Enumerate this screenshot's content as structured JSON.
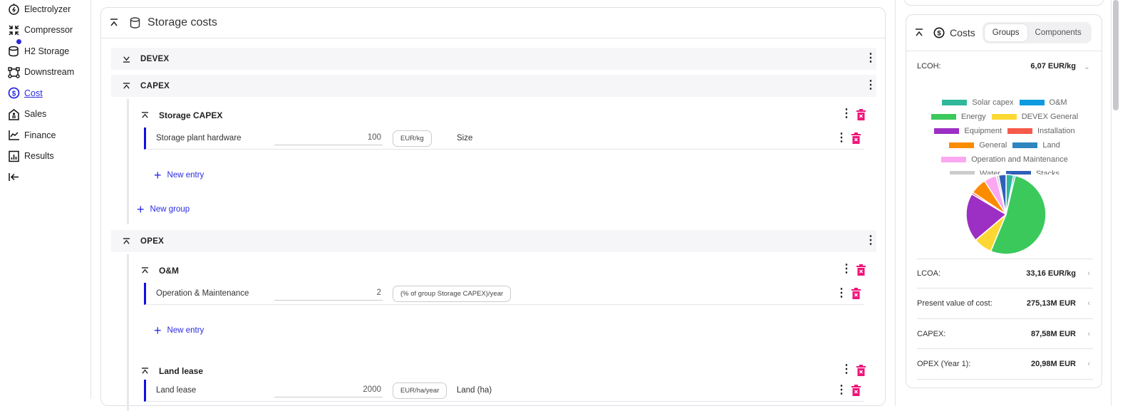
{
  "sidebar": {
    "items": [
      {
        "label": "Electrolyzer",
        "icon": "electrolyzer-icon"
      },
      {
        "label": "Compressor",
        "icon": "compressor-icon"
      },
      {
        "label": "H2 Storage",
        "icon": "storage-icon"
      },
      {
        "label": "Downstream",
        "icon": "downstream-icon"
      },
      {
        "label": "Cost",
        "icon": "dollar-icon",
        "active": true
      },
      {
        "label": "Sales",
        "icon": "sales-icon"
      },
      {
        "label": "Finance",
        "icon": "chart-line-icon"
      },
      {
        "label": "Results",
        "icon": "results-icon"
      }
    ],
    "collapse_icon": "collapse-left-icon"
  },
  "main": {
    "title": "Storage costs",
    "sections": [
      {
        "label": "DEVEX",
        "collapsed": true
      },
      {
        "label": "CAPEX"
      },
      {
        "label": "OPEX"
      }
    ],
    "groups": [
      {
        "label": "Storage CAPEX",
        "entries": [
          {
            "name": "Storage plant hardware",
            "value": "100",
            "unit": "EUR/kg",
            "extra": "Size"
          }
        ],
        "new_entry": "New entry"
      },
      {
        "label": "O&M",
        "entries": [
          {
            "name": "Operation & Maintenance",
            "value": "2",
            "unit": "(% of group Storage CAPEX)/year"
          }
        ],
        "new_entry": "New entry"
      },
      {
        "label": "Land lease",
        "entries": [
          {
            "name": "Land lease",
            "value": "2000",
            "unit": "EUR/ha/year",
            "extra": "Land (ha)"
          }
        ]
      }
    ],
    "new_group": "New group"
  },
  "costs": {
    "title": "Costs",
    "tabs": [
      "Groups",
      "Components"
    ],
    "active_tab": "Groups",
    "lcoh": {
      "label": "LCOH:",
      "value": "6,07 EUR/kg"
    },
    "metrics": [
      {
        "label": "LCOA:",
        "value": "33,16 EUR/kg"
      },
      {
        "label": "Present value of cost:",
        "value": "275,13M EUR"
      },
      {
        "label": "CAPEX:",
        "value": "87,58M EUR"
      },
      {
        "label": "OPEX (Year 1):",
        "value": "20,98M EUR"
      }
    ]
  },
  "chart_data": {
    "type": "pie",
    "legend_position": "top",
    "series": [
      {
        "name": "Solar capex",
        "value": 3,
        "color": "#2fb89a"
      },
      {
        "name": "O&M",
        "value": 0.7,
        "color": "#0d9ae0"
      },
      {
        "name": "Energy",
        "value": 52,
        "color": "#3cc95c"
      },
      {
        "name": "DEVEX General",
        "value": 7.5,
        "color": "#fdd835"
      },
      {
        "name": "Equipment",
        "value": 19.5,
        "color": "#9c2fc4"
      },
      {
        "name": "Installation",
        "value": 0.8,
        "color": "#f65a4a"
      },
      {
        "name": "General",
        "value": 6.5,
        "color": "#fb8c00"
      },
      {
        "name": "Land",
        "value": 0,
        "color": "#2f86c0"
      },
      {
        "name": "Operation and Maintenance",
        "value": 5,
        "color": "#fba8f0"
      },
      {
        "name": "Water",
        "value": 1,
        "color": "#cccccc"
      },
      {
        "name": "Stacks",
        "value": 3,
        "color": "#2f5fb8"
      }
    ]
  },
  "colors": {
    "accent": "#2a2ae0",
    "delete": "#f0147a"
  }
}
